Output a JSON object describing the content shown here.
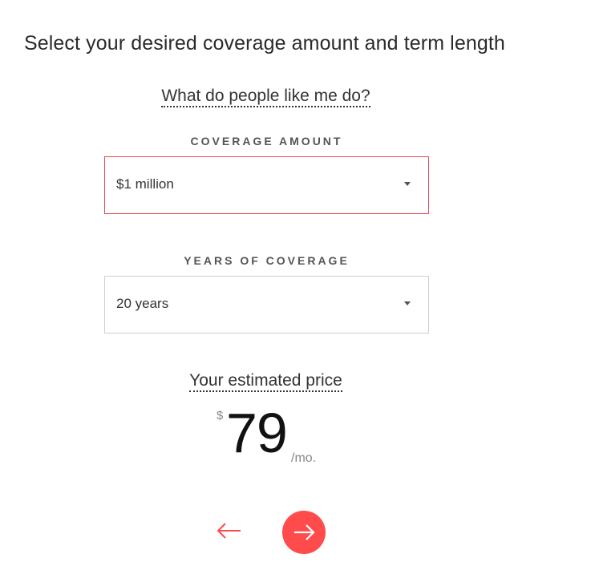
{
  "page": {
    "title": "Select your desired coverage amount and term length",
    "peers_link": "What do people like me do?"
  },
  "coverage_amount": {
    "label": "COVERAGE AMOUNT",
    "selected": "$1 million"
  },
  "years_of_coverage": {
    "label": "YEARS OF COVERAGE",
    "selected": "20 years"
  },
  "estimate": {
    "label": "Your estimated price",
    "currency": "$",
    "amount": "79",
    "unit": "/mo."
  },
  "navigation": {
    "back_icon": "arrow-left-icon",
    "next_icon": "arrow-right-icon"
  },
  "colors": {
    "accent": "#ff4b4b",
    "active_border": "#e8474e",
    "text": "#333333"
  }
}
